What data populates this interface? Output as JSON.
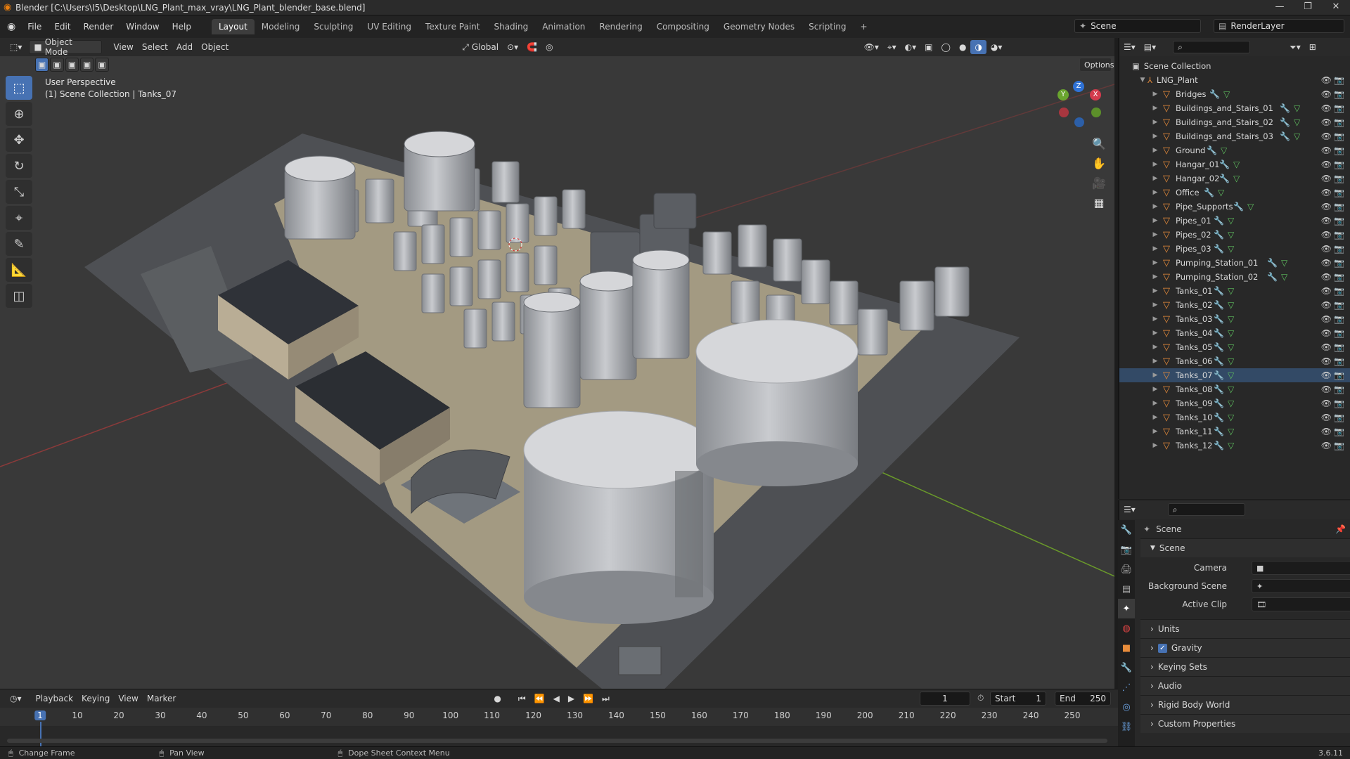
{
  "window": {
    "title": "Blender [C:\\Users\\I5\\Desktop\\LNG_Plant_max_vray\\LNG_Plant_blender_base.blend]",
    "min": "—",
    "max": "❐",
    "close": "✕"
  },
  "menu": [
    "File",
    "Edit",
    "Render",
    "Window",
    "Help"
  ],
  "workspaces": [
    "Layout",
    "Modeling",
    "Sculpting",
    "UV Editing",
    "Texture Paint",
    "Shading",
    "Animation",
    "Rendering",
    "Compositing",
    "Geometry Nodes",
    "Scripting",
    "+"
  ],
  "scene": {
    "name": "Scene",
    "layer": "RenderLayer"
  },
  "viewport": {
    "mode": "Object Mode",
    "menus": [
      "View",
      "Select",
      "Add",
      "Object"
    ],
    "transform": "Global",
    "options": "Options",
    "info_line1": "User Perspective",
    "info_line2": "(1) Scene Collection | Tanks_07",
    "gizmo": {
      "x": "X",
      "y": "Y",
      "z": "Z"
    }
  },
  "outliner": {
    "root": "Scene Collection",
    "collection": "LNG_Plant",
    "objects": [
      "Bridges",
      "Buildings_and_Stairs_01",
      "Buildings_and_Stairs_02",
      "Buildings_and_Stairs_03",
      "Ground",
      "Hangar_01",
      "Hangar_02",
      "Office",
      "Pipe_Supports",
      "Pipes_01",
      "Pipes_02",
      "Pipes_03",
      "Pumping_Station_01",
      "Pumping_Station_02",
      "Tanks_01",
      "Tanks_02",
      "Tanks_03",
      "Tanks_04",
      "Tanks_05",
      "Tanks_06",
      "Tanks_07",
      "Tanks_08",
      "Tanks_09",
      "Tanks_10",
      "Tanks_11",
      "Tanks_12"
    ],
    "selected": "Tanks_07"
  },
  "properties": {
    "context": "Scene",
    "section": "Scene",
    "camera_label": "Camera",
    "bg_label": "Background Scene",
    "clip_label": "Active Clip",
    "panels": [
      "Units",
      "Gravity",
      "Keying Sets",
      "Audio",
      "Rigid Body World",
      "Custom Properties"
    ],
    "gravity_checked": true
  },
  "timeline": {
    "menus": [
      "Playback",
      "Keying",
      "View",
      "Marker"
    ],
    "current": "1",
    "start_label": "Start",
    "start": "1",
    "end_label": "End",
    "end": "250",
    "ticks": [
      "1",
      "10",
      "20",
      "30",
      "40",
      "50",
      "60",
      "70",
      "80",
      "90",
      "100",
      "110",
      "120",
      "130",
      "140",
      "150",
      "160",
      "170",
      "180",
      "190",
      "200",
      "210",
      "220",
      "230",
      "240",
      "250"
    ]
  },
  "status": {
    "a": "Change Frame",
    "b": "Pan View",
    "c": "Dope Sheet Context Menu",
    "version": "3.6.11"
  }
}
